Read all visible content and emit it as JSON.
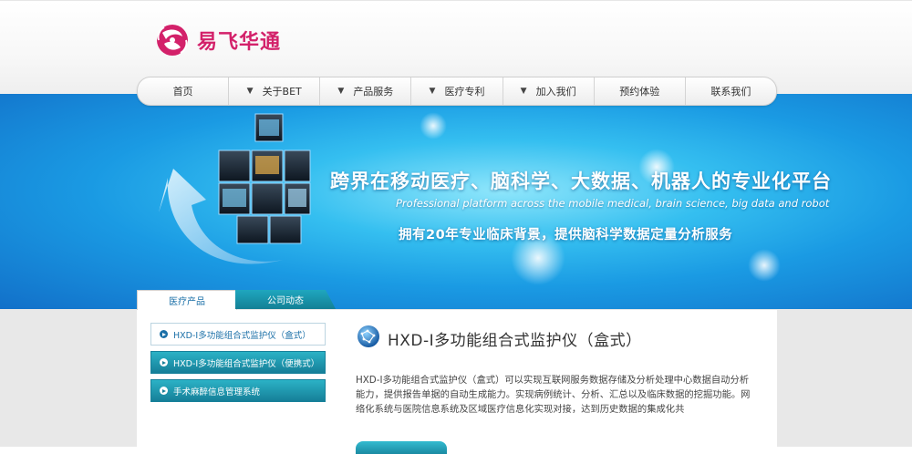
{
  "brand": {
    "name": "易飞华通",
    "color": "#d3216a"
  },
  "nav": {
    "items": [
      {
        "label": "首页",
        "has_caret": false
      },
      {
        "label": "关于BET",
        "has_caret": true
      },
      {
        "label": "产品服务",
        "has_caret": true
      },
      {
        "label": "医疗专利",
        "has_caret": true
      },
      {
        "label": "加入我们",
        "has_caret": true
      },
      {
        "label": "预约体验",
        "has_caret": false
      },
      {
        "label": "联系我们",
        "has_caret": false
      }
    ]
  },
  "banner": {
    "title": "跨界在移动医疗、脑科学、大数据、机器人的专业化平台",
    "subtitle": "Professional platform across the mobile medical, brain science, big data and robot",
    "description": "拥有20年专业临床背景，提供脑科学数据定量分析服务"
  },
  "tabs": [
    {
      "label": "医疗产品",
      "active": true
    },
    {
      "label": "公司动态",
      "active": false
    }
  ],
  "sidebar": {
    "items": [
      {
        "label": "HXD-I多功能组合式监护仪（盒式）",
        "selected": true
      },
      {
        "label": "HXD-I多功能组合式监护仪（便携式）",
        "selected": false
      },
      {
        "label": "手术麻醉信息管理系统",
        "selected": false
      }
    ]
  },
  "product": {
    "title": "HXD-I多功能组合式监护仪（盒式）",
    "description": "HXD-I多功能组合式监护仪（盒式）可以实现互联网服务数据存储及分析处理中心数据自动分析能力，提供报告单据的自动生成能力。实现病例统计、分析、汇总以及临床数据的挖掘功能。网络化系统与医院信息系统及区域医疗信息化实现对接，达到历史数据的集成化共"
  },
  "colors": {
    "accent": "#1fa7bf",
    "banner": "#1a9ae3"
  }
}
